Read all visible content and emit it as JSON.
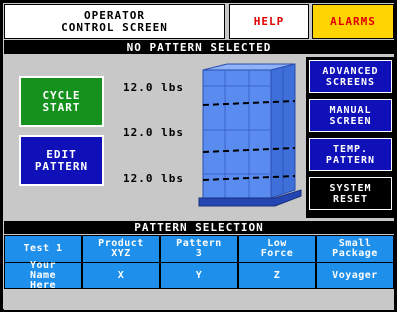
{
  "header": {
    "title_line1": "OPERATOR",
    "title_line2": "CONTROL SCREEN",
    "help_label": "HELP",
    "alarms_label": "ALARMS"
  },
  "status": {
    "text": "NO PATTERN SELECTED"
  },
  "controls": {
    "cycle_start_line1": "CYCLE",
    "cycle_start_line2": "START",
    "edit_pattern_line1": "EDIT",
    "edit_pattern_line2": "PATTERN"
  },
  "weights": [
    "12.0 lbs",
    "12.0 lbs",
    "12.0 lbs"
  ],
  "side_menu": [
    {
      "line1": "ADVANCED",
      "line2": "SCREENS"
    },
    {
      "line1": "MANUAL",
      "line2": "SCREEN"
    },
    {
      "line1": "TEMP.",
      "line2": "PATTERN"
    },
    {
      "line1": "SYSTEM",
      "line2": "RESET"
    }
  ],
  "pattern_selection": {
    "title": "PATTERN SELECTION",
    "row1": [
      {
        "line1": "Test 1",
        "line2": ""
      },
      {
        "line1": "Product",
        "line2": "XYZ"
      },
      {
        "line1": "Pattern",
        "line2": "3"
      },
      {
        "line1": "Low",
        "line2": "Force"
      },
      {
        "line1": "Small",
        "line2": "Package"
      }
    ],
    "row2": [
      {
        "line1": "Your",
        "line2": "Name",
        "line3": "Here"
      },
      {
        "line1": "X"
      },
      {
        "line1": "Y"
      },
      {
        "line1": "Z"
      },
      {
        "line1": "Voyager"
      }
    ]
  },
  "colors": {
    "cycle_start_bg": "#15921e",
    "edit_pattern_bg": "#1010b8",
    "side_menu_bg": "#1010b8",
    "grid_cell_bg": "#1e8fea",
    "alarms_bg": "#ffd400",
    "help_text": "#e00000",
    "pallet_load": "#5a8cf0"
  }
}
